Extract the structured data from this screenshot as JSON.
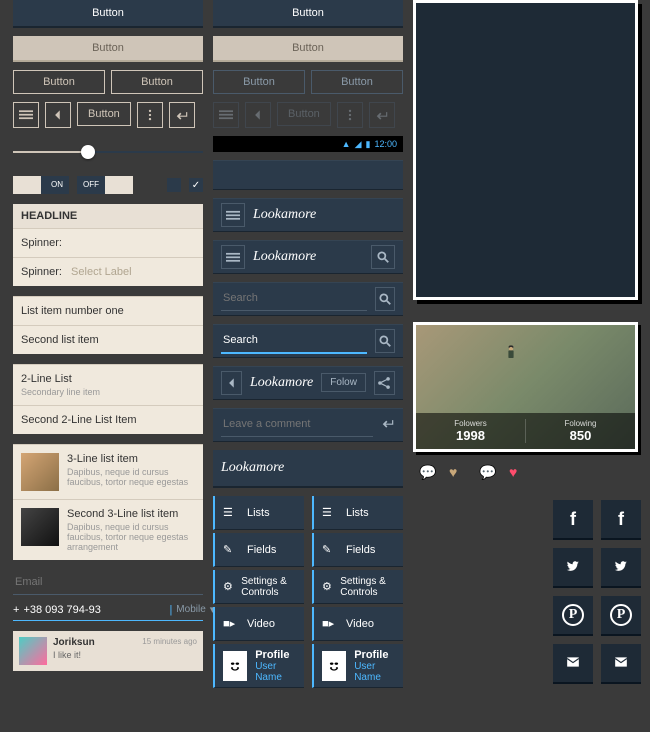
{
  "buttons": {
    "label": "Button",
    "follow": "Folow"
  },
  "toggles": {
    "on": "ON",
    "off": "OFF"
  },
  "light": {
    "headline": "HEADLINE",
    "spinner1": "Spinner:",
    "spinner2": "Spinner:",
    "select_label": "Select Label",
    "lists": {
      "one": [
        "List item number one",
        "Second list item"
      ],
      "two": [
        {
          "title": "2-Line List",
          "sub": "Secondary line item"
        },
        {
          "title": "Second 2-Line List Item"
        }
      ],
      "three": [
        {
          "title": "3-Line list item",
          "sub": "Dapibus, neque id cursus faucibus, tortor neque egestas"
        },
        {
          "title": "Second 3-Line list item",
          "sub": "Dapibus, neque id cursus faucibus, tortor neque egestas arrangement"
        }
      ]
    }
  },
  "inputs": {
    "email": "Email",
    "phone": "+38 093 794-93",
    "phone_type": "Mobile",
    "search": "Search",
    "comment": "Leave a comment"
  },
  "comment": {
    "name": "Joriksun",
    "text": "I like it!",
    "time": "15 minutes ago"
  },
  "status": {
    "time": "12:00"
  },
  "brand": "Lookamore",
  "menu": {
    "lists": "Lists",
    "fields": "Fields",
    "settings": "Settings & Controls",
    "video": "Video",
    "profile": "Profile",
    "username": "User Name"
  },
  "stats": {
    "followers_label": "Folowers",
    "followers": "1998",
    "following_label": "Folowing",
    "following": "850"
  }
}
